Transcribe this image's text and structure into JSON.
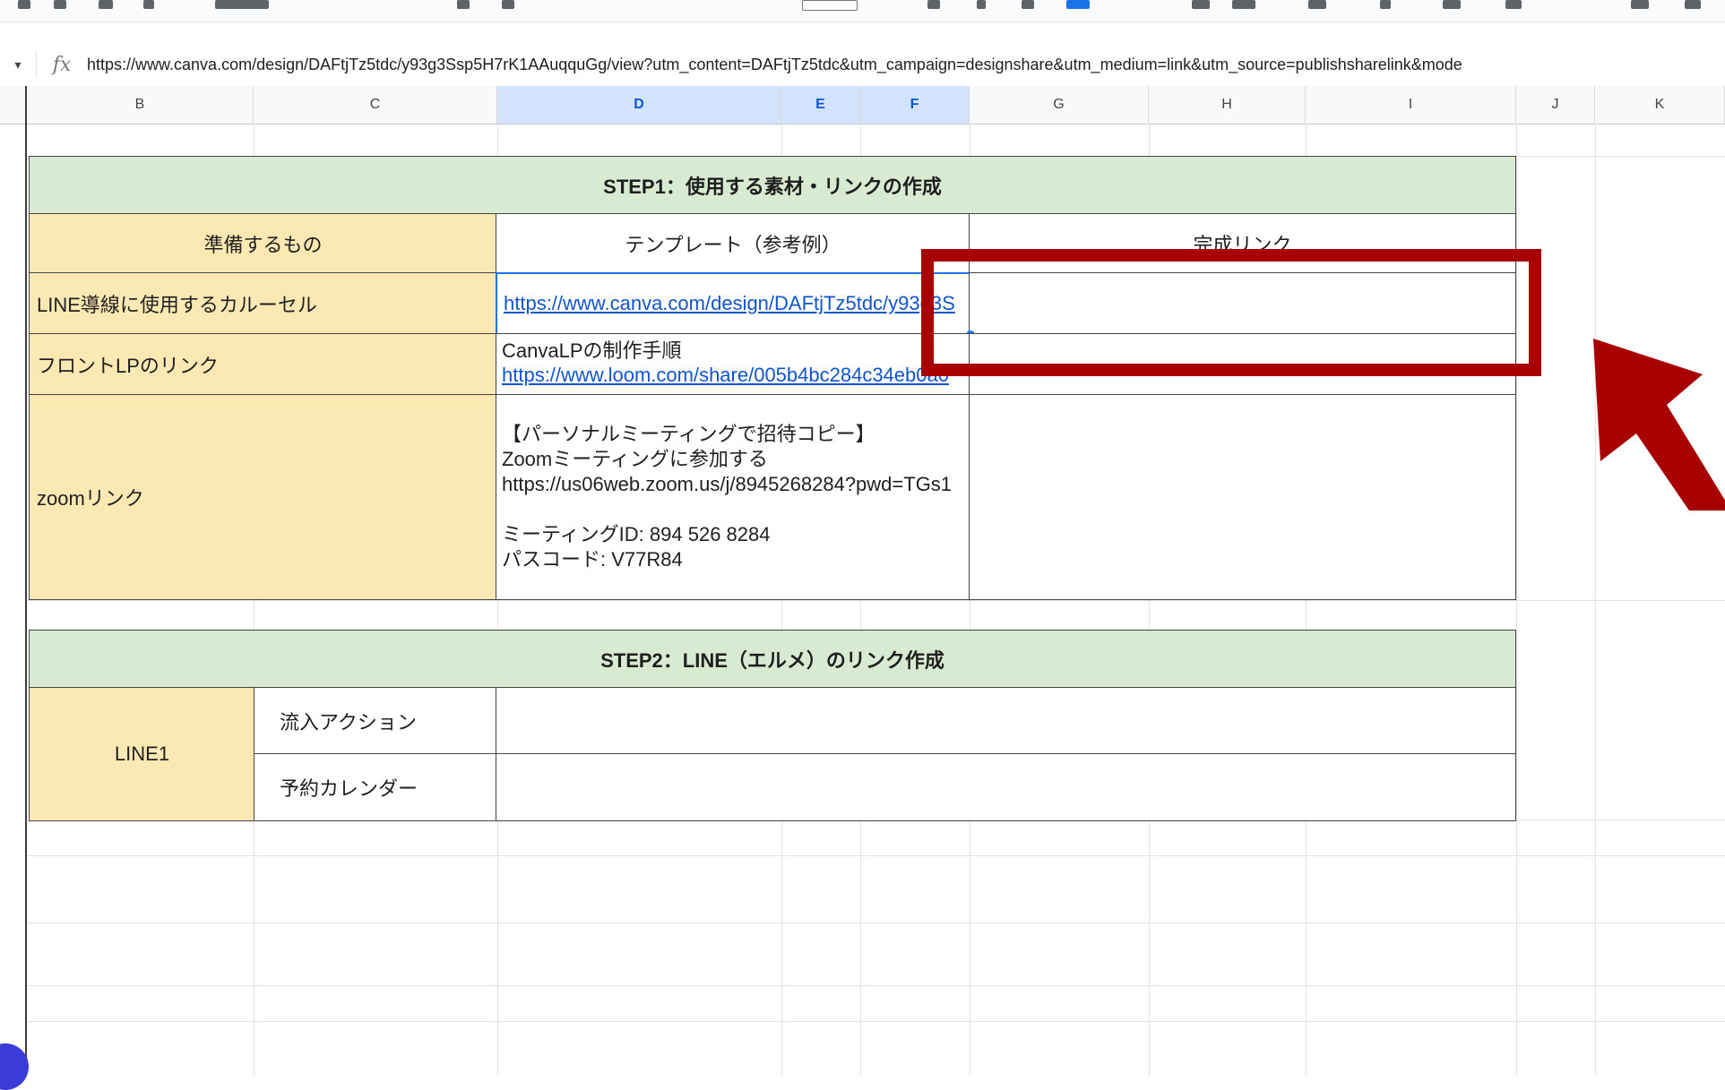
{
  "formula_bar": {
    "caret": "▾",
    "fx_label": "fx",
    "value": "https://www.canva.com/design/DAFtjTz5tdc/y93g3Ssp5H7rK1AAuqquGg/view?utm_content=DAFtjTz5tdc&utm_campaign=designshare&utm_medium=link&utm_source=publishsharelink&mode"
  },
  "columns": [
    "B",
    "C",
    "D",
    "E",
    "F",
    "G",
    "H",
    "I",
    "J",
    "K"
  ],
  "step1": {
    "title": "STEP1：使用する素材・リンクの作成",
    "header_prepare": "準備するもの",
    "header_template": "テンプレート（参考例）",
    "header_complete": "完成リンク",
    "rows": [
      {
        "label": "LINE導線に使用するカルーセル",
        "link": "https://www.canva.com/design/DAFtjTz5tdc/y93g3S"
      },
      {
        "label": "フロントLPのリンク",
        "text": "CanvaLPの制作手順",
        "link": "https://www.loom.com/share/005b4bc284c34eb0a0"
      },
      {
        "label": "zoomリンク",
        "lines": [
          "【パーソナルミーティングで招待コピー】",
          "Zoomミーティングに参加する",
          "https://us06web.zoom.us/j/8945268284?pwd=TGs1",
          "",
          "ミーティングID: 894 526 8284",
          "パスコード: V77R84"
        ]
      }
    ]
  },
  "step2": {
    "title": "STEP2：LINE（エルメ）のリンク作成",
    "line_label": "LINE1",
    "sub_rows": [
      "流入アクション",
      "予約カレンダー"
    ]
  },
  "colors": {
    "header_green": "#d9ead3",
    "label_yellow": "#fce8b2",
    "annotation_red": "#a80000",
    "link_blue": "#1155cc"
  }
}
